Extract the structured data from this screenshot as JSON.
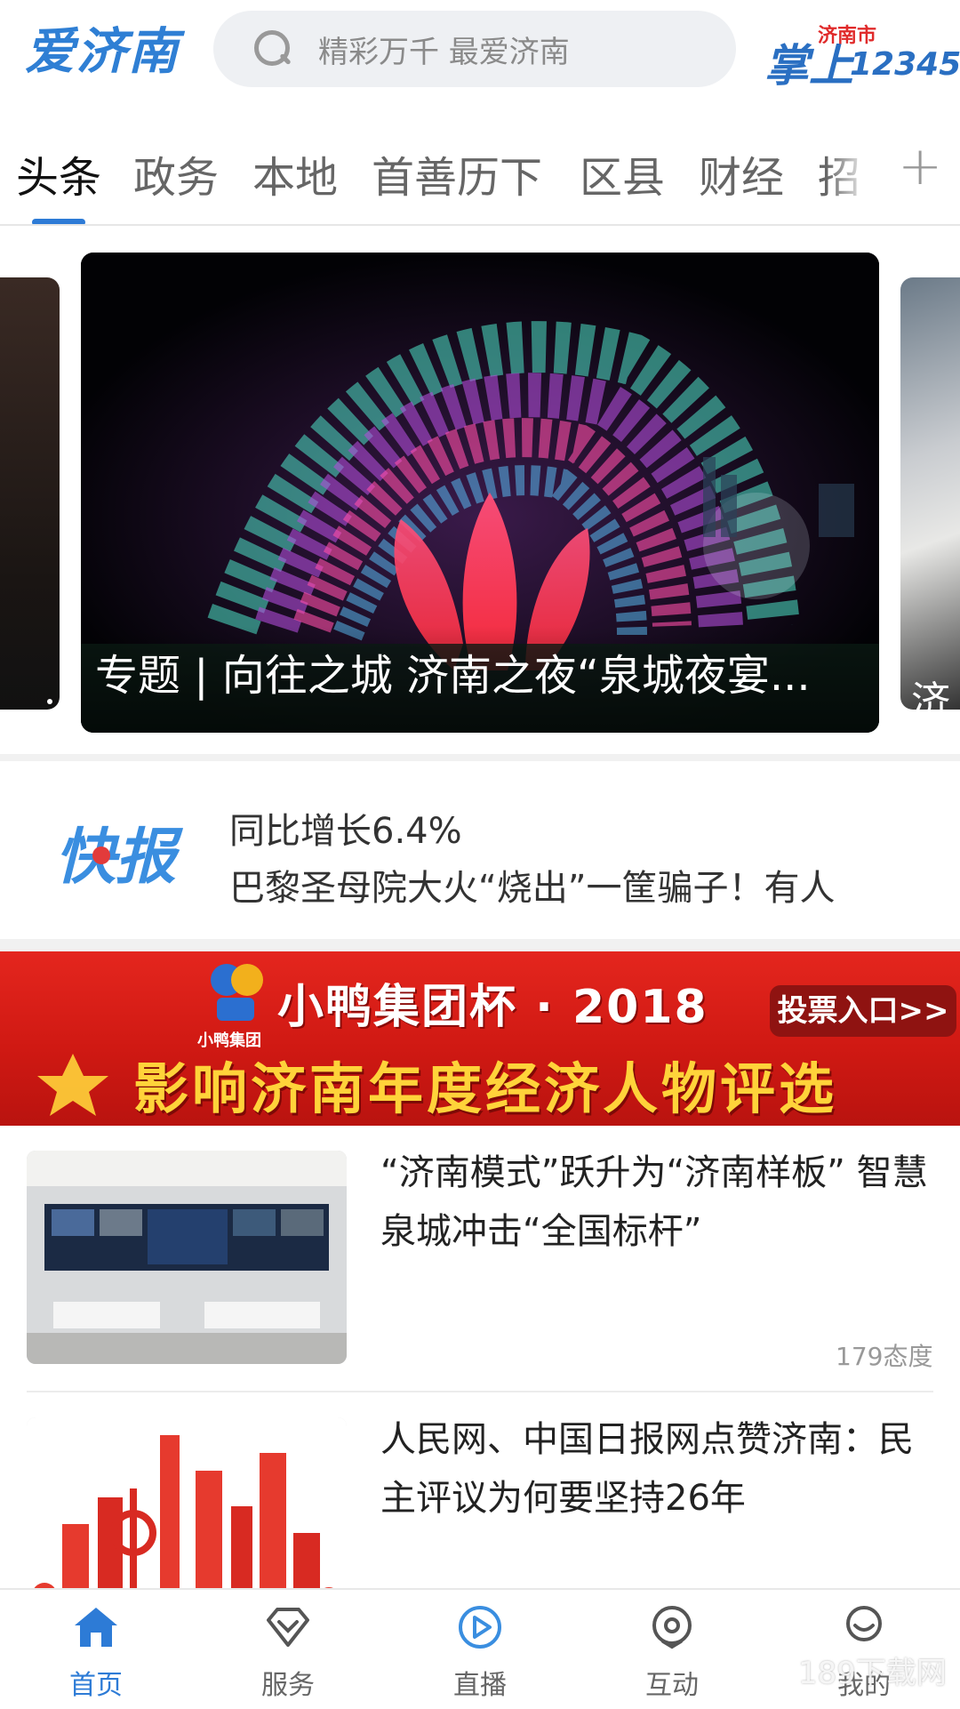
{
  "header": {
    "logo": "爱济南",
    "search_placeholder": "精彩万千 最爱济南",
    "hotline_logo_main": "掌上",
    "hotline_logo_city": "济南市",
    "hotline_logo_number": "12345"
  },
  "tabs": [
    {
      "label": "头条",
      "active": true
    },
    {
      "label": "政务"
    },
    {
      "label": "本地"
    },
    {
      "label": "首善历下"
    },
    {
      "label": "区县"
    },
    {
      "label": "财经"
    },
    {
      "label": "招"
    }
  ],
  "tabs_more_label": "+",
  "carousel": {
    "main_caption": "专题 | 向往之城 济南之夜“泉城夜宴...",
    "right_caption": "济"
  },
  "flash": {
    "logo": "快报",
    "line1": "同比增长6.4%",
    "line2": "巴黎圣母院大火“烧出”一筐骗子！有人"
  },
  "banner": {
    "mascot_caption": "小鸭集团",
    "title": "小鸭集团杯 · 2018",
    "vote_button": "投票入口>>",
    "subtitle": "影响济南年度经济人物评选"
  },
  "news": [
    {
      "title": "“济南模式”跃升为“济南样板” 智慧泉城冲击“全国标杆”",
      "meta": "179态度"
    },
    {
      "title": "人民网、中国日报网点赞济南：民主评议为何要坚持26年",
      "meta": ""
    }
  ],
  "bottom_nav": [
    {
      "label": "首页",
      "icon": "home-icon",
      "active": true
    },
    {
      "label": "服务",
      "icon": "diamond-icon"
    },
    {
      "label": "直播",
      "icon": "play-icon"
    },
    {
      "label": "互动",
      "icon": "location-pin-icon"
    },
    {
      "label": "我的",
      "icon": "user-icon"
    }
  ],
  "watermark": "189下载网",
  "colors": {
    "accent": "#2d7bd6",
    "logo_blue": "#2f7fd4",
    "banner_red": "#d01913",
    "banner_gold": "#ffd33a"
  }
}
